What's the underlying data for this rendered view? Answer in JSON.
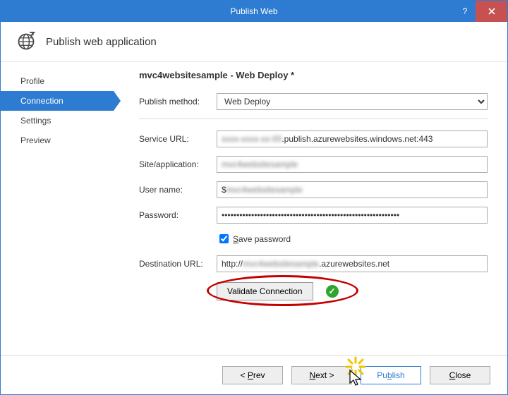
{
  "window": {
    "title": "Publish Web"
  },
  "header": {
    "title": "Publish web application"
  },
  "sidebar": {
    "items": [
      {
        "label": "Profile"
      },
      {
        "label": "Connection"
      },
      {
        "label": "Settings"
      },
      {
        "label": "Preview"
      }
    ]
  },
  "content": {
    "profile_title": "mvc4websitesample - Web Deploy *",
    "publish_method_label": "Publish method:",
    "publish_method_value": "Web Deploy",
    "service_url_label": "Service URL:",
    "service_url_prefix_redacted": "xxxx-xxxx-xx-00",
    "service_url_suffix": ".publish.azurewebsites.windows.net:443",
    "site_app_label": "Site/application:",
    "site_app_value_redacted": "mvc4websitesample",
    "username_label": "User name:",
    "username_prefix": "$",
    "username_value_redacted": "mvc4websitesample",
    "password_label": "Password:",
    "password_value": "••••••••••••••••••••••••••••••••••••••••••••••••••••••••••••",
    "save_password_label_pre": "S",
    "save_password_label_rest": "ave password",
    "save_password_checked": true,
    "destination_label": "Destination URL:",
    "destination_prefix": "http://",
    "destination_mid_redacted": "mvc4websitesample",
    "destination_suffix": ".azurewebsites.net",
    "validate_label": "Validate Connection"
  },
  "footer": {
    "prev": "< Prev",
    "next": "Next >",
    "publish": "Publish",
    "close": "Close"
  }
}
